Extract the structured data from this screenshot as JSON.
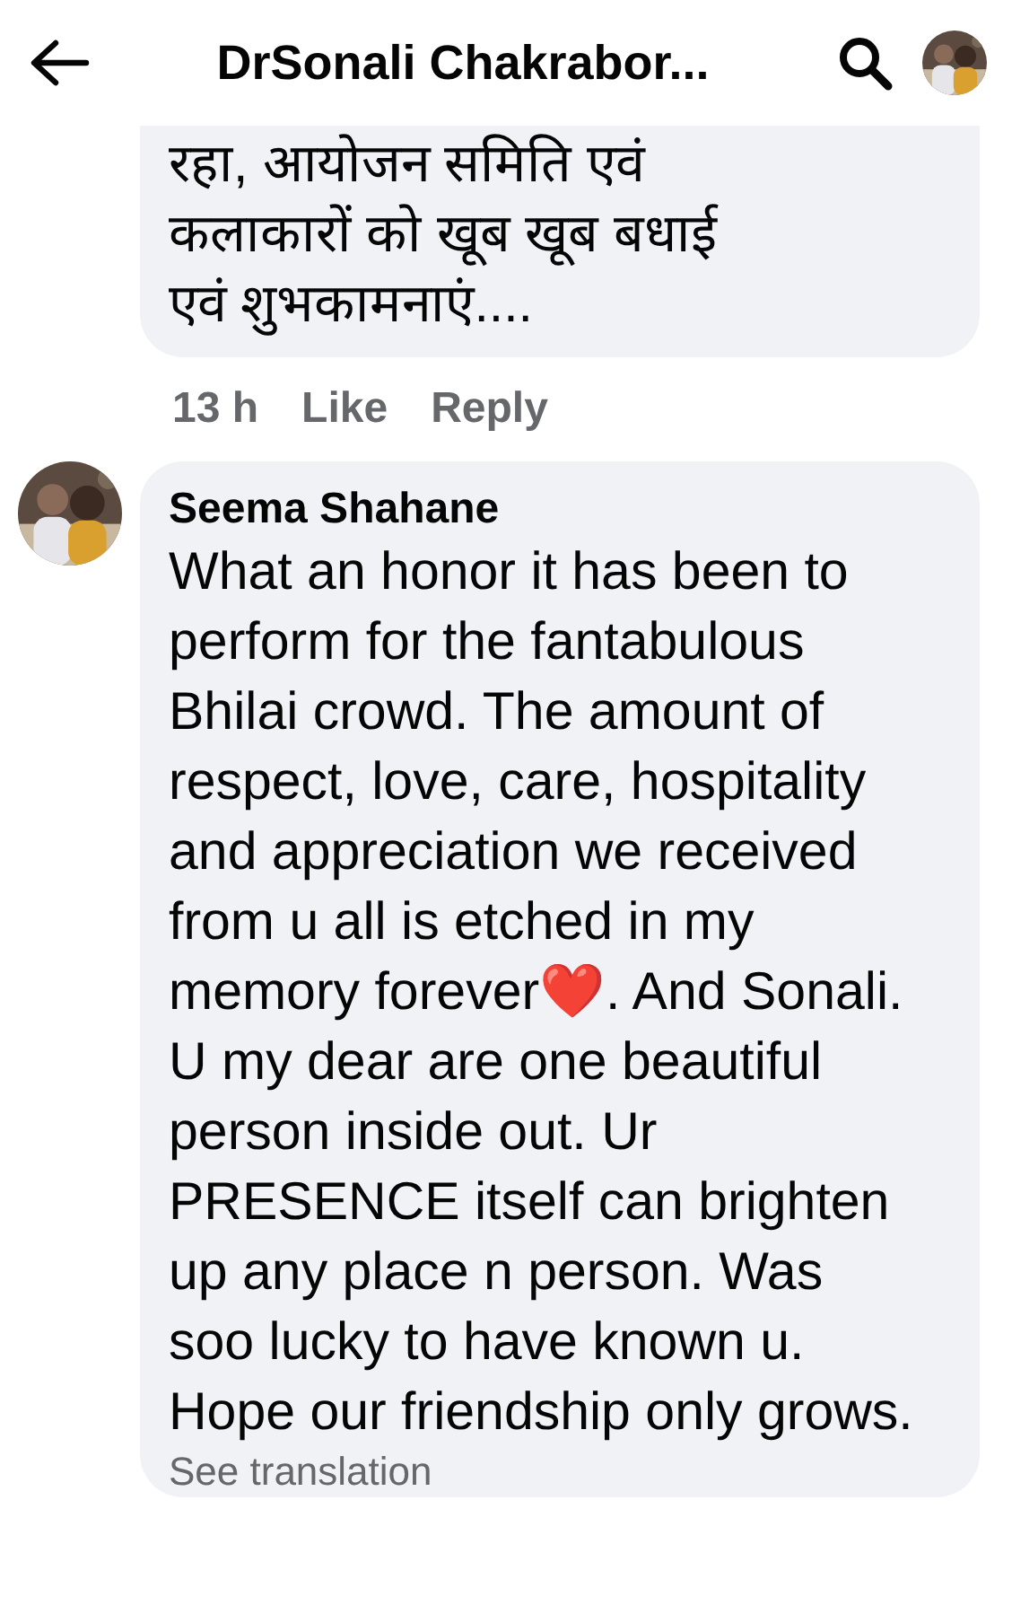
{
  "header": {
    "title": "DrSonali Chakrabor..."
  },
  "comments": [
    {
      "kind": "reply",
      "text": "रहा, आयोजन समिति एवं कलाकारों को खूब खूब बधाई एवं शुभकामनाएं....",
      "meta": {
        "time": "13 h",
        "like": "Like",
        "reply": "Reply"
      }
    },
    {
      "kind": "comment",
      "author": "Seema Shahane",
      "text": "What an honor it has been to perform for the fantabulous Bhilai crowd. The amount of respect, love, care, hospitality and appreciation we received from u all is etched in my memory forever❤️. And Sonali.   U my dear are one beautiful person inside out. Ur PRESENCE itself can brighten up any place n person. Was soo lucky to have known u. Hope our friendship only grows.",
      "see_translation": "See translation"
    }
  ]
}
